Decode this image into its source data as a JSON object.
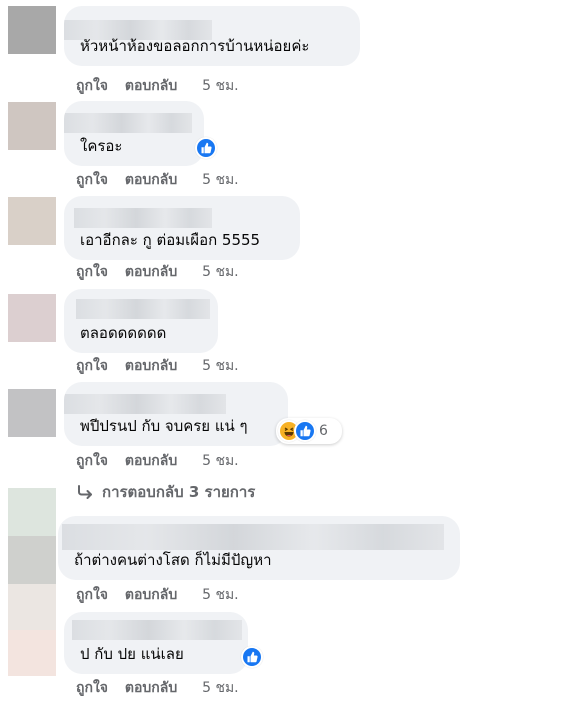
{
  "actions": {
    "like_label": "ถูกใจ",
    "reply_label": "ตอบกลับ",
    "time_label": "5 ชม."
  },
  "comments": [
    {
      "text": "หัวหน้าห้องขอลอกการบ้านหน่อยค่ะ",
      "reactions": []
    },
    {
      "text": "ใครอะ",
      "reactions": [
        "like"
      ]
    },
    {
      "text": "เอาอีกละ กู ต่อมเผือก 5555",
      "reactions": []
    },
    {
      "text": "ตลอดดดดดด",
      "reactions": []
    },
    {
      "text": "พปีปรนป กับ จบครย แน่ ๆ",
      "reactions": [
        "haha",
        "like"
      ],
      "reaction_count": "6"
    },
    {
      "text": "ถ้าต่างคนต่างโสด ก็ไม่มีปัญหา",
      "reactions": []
    },
    {
      "text": "ป กับ ปย แน่เลย",
      "reactions": [
        "like"
      ]
    }
  ],
  "view_replies": {
    "label": "การตอบกลับ 3 รายการ"
  },
  "colors": {
    "bubble": "#f0f2f5",
    "meta_text": "#65676b",
    "like_blue": "#1877f2",
    "haha_yellow": "#f7b125"
  },
  "icons": [
    "like-icon",
    "haha-icon",
    "reply-arrow-icon"
  ]
}
